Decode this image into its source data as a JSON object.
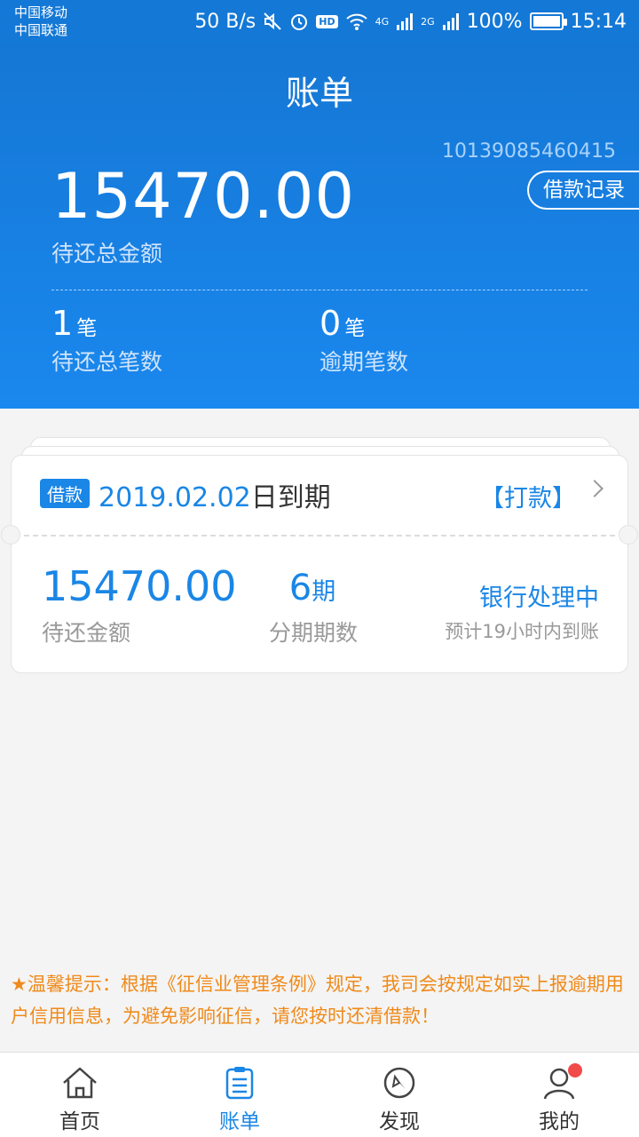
{
  "statusbar": {
    "carrier1": "中国移动",
    "carrier2": "中国联通",
    "speed": "50 B/s",
    "hd": "HD",
    "net1": "4G",
    "net2": "2G",
    "battery": "100%",
    "battery_level": 1.0,
    "time": "15:14"
  },
  "header": {
    "title": "账单",
    "account_no": "10139085460415",
    "loan_record_btn": "借款记录",
    "total_amount": "15470.00",
    "total_label": "待还总金额",
    "pending_count": "1",
    "pending_unit": "笔",
    "pending_label": "待还总笔数",
    "overdue_count": "0",
    "overdue_unit": "笔",
    "overdue_label": "逾期笔数"
  },
  "card": {
    "tag": "借款",
    "due_date": "2019.02.02",
    "due_suffix": "日到期",
    "pay_label": "【打款】",
    "amount": "15470.00",
    "amount_label": "待还金额",
    "periods": "6",
    "periods_unit": "期",
    "periods_label": "分期期数",
    "status": "银行处理中",
    "status_sub": "预计19小时内到账"
  },
  "tips": "★温馨提示：根据《征信业管理条例》规定，我司会按规定如实上报逾期用户信用信息，为避免影响征信，请您按时还清借款！",
  "tabs": [
    {
      "label": "首页",
      "icon": "home-icon"
    },
    {
      "label": "账单",
      "icon": "bill-icon"
    },
    {
      "label": "发现",
      "icon": "compass-icon"
    },
    {
      "label": "我的",
      "icon": "user-icon"
    }
  ],
  "colors": {
    "primary": "#1a86e6",
    "header": "#1577d5",
    "tip": "#ef8a1a",
    "badge": "#f04a4a"
  }
}
